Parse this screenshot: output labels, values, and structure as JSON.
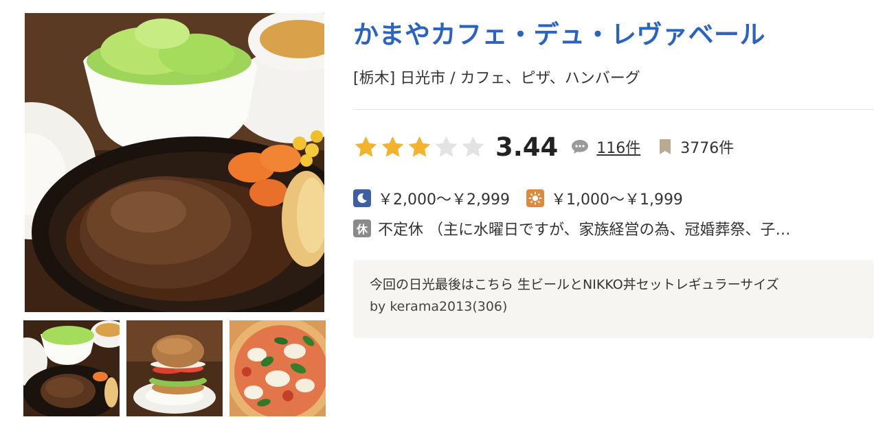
{
  "shop": {
    "name": "かまやカフェ・デュ・レヴァベール",
    "area_genre": "[栃木] 日光市 / カフェ、ピザ、ハンバーグ"
  },
  "rating": {
    "stars_filled": 3,
    "stars_total": 5,
    "score": "3.44",
    "review_count": "116件",
    "save_count": "3776件"
  },
  "budget": {
    "night": "￥2,000～￥2,999",
    "day": "￥1,000～￥1,999"
  },
  "holiday": {
    "badge": "休",
    "text": "不定休 （主に水曜日ですが、家族経営の為、冠婚葬祭、子…"
  },
  "review": {
    "text": "今回の日光最後はこちら 生ビールとNIKKO丼セットレギュラーサイズ",
    "by": "by kerama2013(306)"
  },
  "colors": {
    "title": "#2b63c0",
    "star_on": "#f3b32f",
    "star_off": "#e3e3e3",
    "night_badge": "#3f5fa3",
    "day_badge": "#d98c3f",
    "holiday_badge": "#8a8a8a",
    "review_bg": "#f6f5f2"
  },
  "icons": {
    "review": "speech-bubble-icon",
    "save": "bookmark-icon",
    "night": "moon-icon",
    "day": "sun-icon"
  }
}
